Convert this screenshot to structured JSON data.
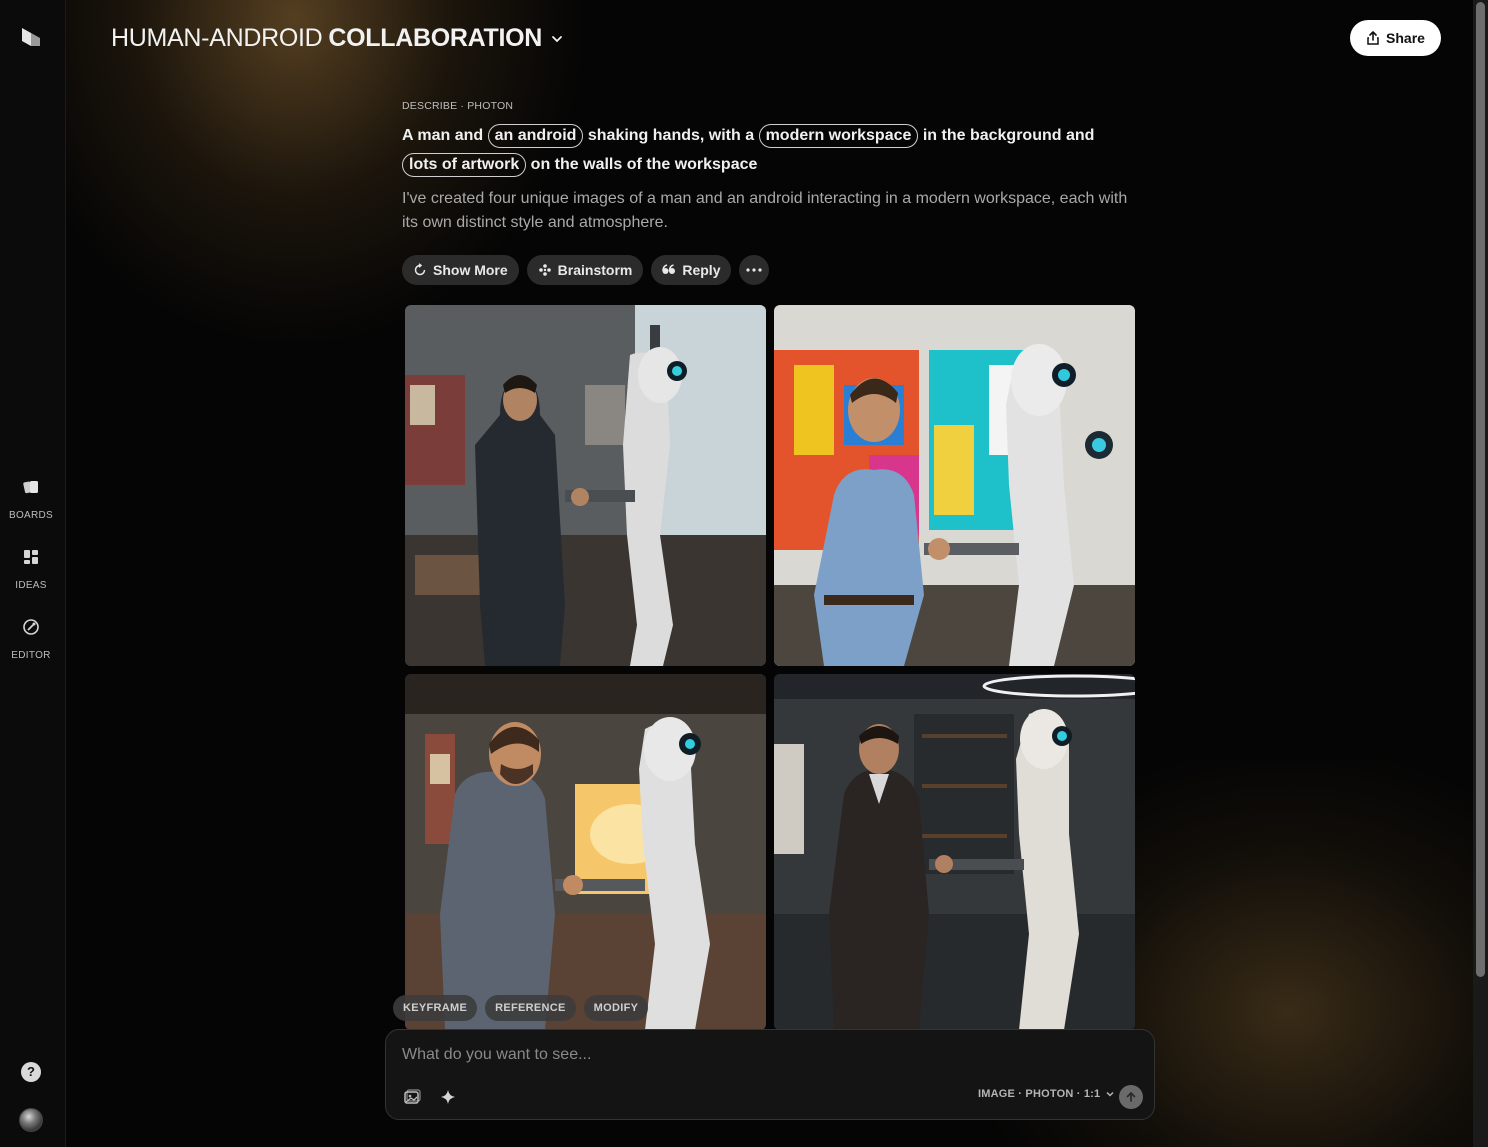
{
  "header": {
    "title_light": "HUMAN-ANDROID",
    "title_bold": "COLLABORATION",
    "share_label": "Share"
  },
  "sidebar": {
    "items": [
      {
        "label": "BOARDS",
        "icon": "boards-icon"
      },
      {
        "label": "IDEAS",
        "icon": "ideas-icon"
      },
      {
        "label": "EDITOR",
        "icon": "editor-icon"
      }
    ],
    "help_label": "?"
  },
  "message": {
    "meta": "DESCRIBE · PHOTON",
    "prompt": {
      "t1": "A man and ",
      "chip1": "an android",
      "t2": " shaking hands, with a ",
      "chip2": "modern workspace",
      "t3": " in the background and ",
      "chip3": "lots of artwork",
      "t4": " on the walls of the workspace"
    },
    "description": "I've created four unique images of a man and an android interacting in a modern workspace, each with its own distinct style and atmosphere.",
    "actions": {
      "show_more": "Show More",
      "brainstorm": "Brainstorm",
      "reply": "Reply"
    }
  },
  "images": [
    {
      "alt": "man in suit shaking hands with android in office"
    },
    {
      "alt": "man in blue shirt shaking hands with android in front of colorful art"
    },
    {
      "alt": "bearded man shaking hands with android in loft studio"
    },
    {
      "alt": "man in dark suit shaking hands with android in dim office"
    }
  ],
  "composer": {
    "tags": [
      "KEYFRAME",
      "REFERENCE",
      "MODIFY"
    ],
    "placeholder": "What do you want to see...",
    "mode": "IMAGE · PHOTON · 1:1"
  },
  "colors": {
    "background": "#050505",
    "accent_glow": "#8a6a35",
    "share_bg": "#ffffff"
  }
}
